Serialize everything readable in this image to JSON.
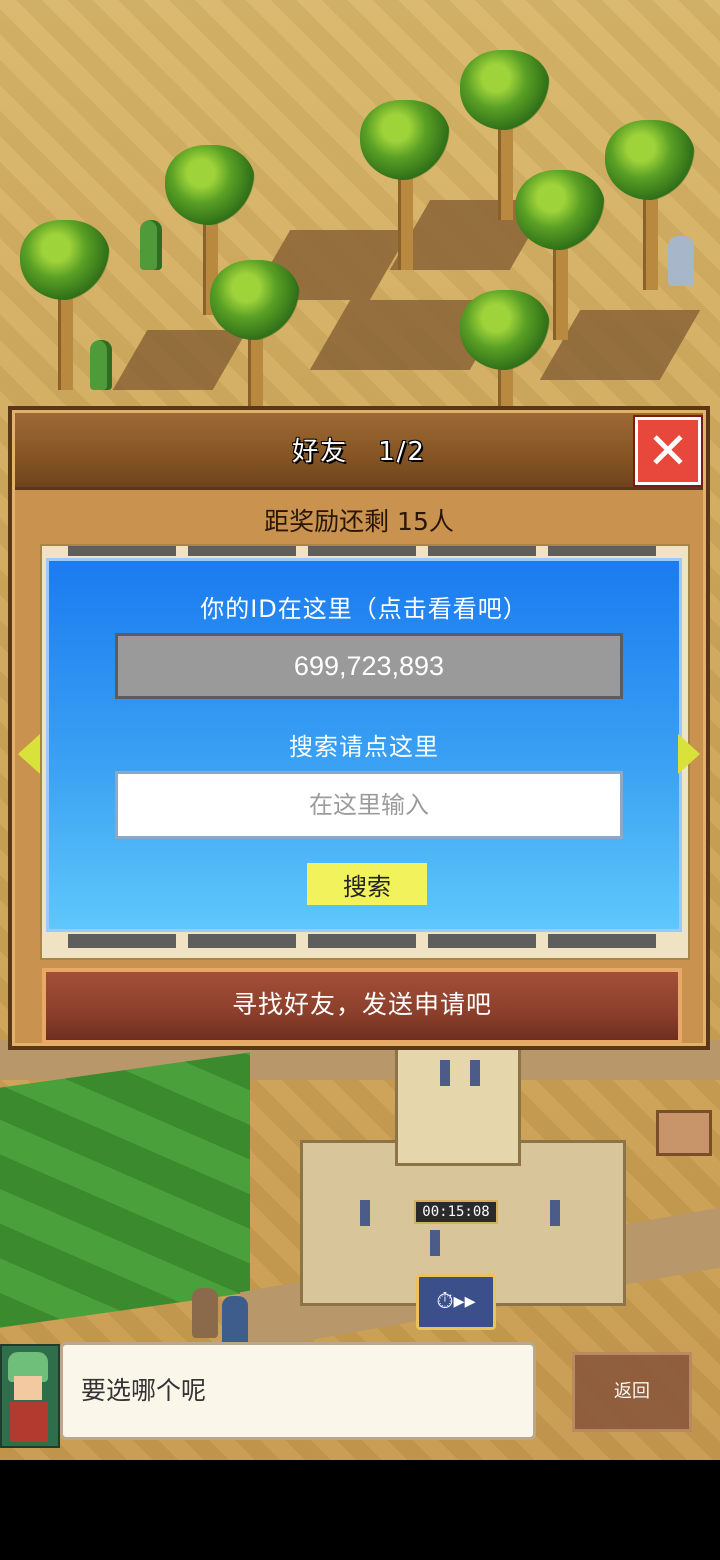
{
  "dialog": {
    "title": "好友",
    "page": "1/2",
    "reward_text": "距奖励还剩 15人",
    "id_label": "你的ID在这里（点击看看吧）",
    "player_id": "699,723,893",
    "search_label": "搜索请点这里",
    "search_placeholder": "在这里输入",
    "search_button": "搜索",
    "find_friends_button": "寻找好友，发送申请吧"
  },
  "world": {
    "timer": "00:15:08"
  },
  "message_bar": {
    "speech": "要选哪个呢",
    "back_button": "返回"
  },
  "icons": {
    "close": "close-icon",
    "prev": "arrow-left-icon",
    "next": "arrow-right-icon",
    "speed": "fast-forward-icon"
  },
  "colors": {
    "close_red": "#e8483c",
    "panel_blue": "#1b7bf0",
    "search_button_yellow": "#f2f25c",
    "find_button": "#8c3f2b"
  }
}
